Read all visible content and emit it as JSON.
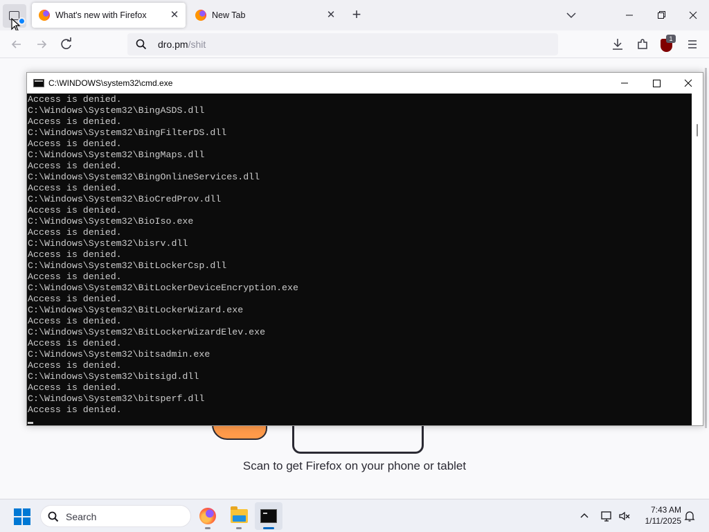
{
  "browser": {
    "tabs": [
      {
        "title": "What's new with Firefox",
        "active": true
      },
      {
        "title": "New Tab",
        "active": false
      }
    ],
    "url": {
      "host": "dro.pm",
      "path": "/shit"
    },
    "extension_badge": "1",
    "page": {
      "scan_text": "Scan to get Firefox on your phone or tablet"
    }
  },
  "cmd": {
    "title": "C:\\WINDOWS\\system32\\cmd.exe",
    "lines": [
      "Access is denied.",
      "C:\\Windows\\System32\\BingASDS.dll",
      "Access is denied.",
      "C:\\Windows\\System32\\BingFilterDS.dll",
      "Access is denied.",
      "C:\\Windows\\System32\\BingMaps.dll",
      "Access is denied.",
      "C:\\Windows\\System32\\BingOnlineServices.dll",
      "Access is denied.",
      "C:\\Windows\\System32\\BioCredProv.dll",
      "Access is denied.",
      "C:\\Windows\\System32\\BioIso.exe",
      "Access is denied.",
      "C:\\Windows\\System32\\bisrv.dll",
      "Access is denied.",
      "C:\\Windows\\System32\\BitLockerCsp.dll",
      "Access is denied.",
      "C:\\Windows\\System32\\BitLockerDeviceEncryption.exe",
      "Access is denied.",
      "C:\\Windows\\System32\\BitLockerWizard.exe",
      "Access is denied.",
      "C:\\Windows\\System32\\BitLockerWizardElev.exe",
      "Access is denied.",
      "C:\\Windows\\System32\\bitsadmin.exe",
      "Access is denied.",
      "C:\\Windows\\System32\\bitsigd.dll",
      "Access is denied.",
      "C:\\Windows\\System32\\bitsperf.dll",
      "Access is denied."
    ]
  },
  "taskbar": {
    "search_label": "Search",
    "time": "7:43 AM",
    "date": "1/11/2025",
    "apps": [
      "firefox",
      "file-explorer",
      "command-prompt"
    ]
  },
  "colors": {
    "console_bg": "#0c0c0c",
    "console_fg": "#cccccc",
    "accent": "#0078d4"
  }
}
